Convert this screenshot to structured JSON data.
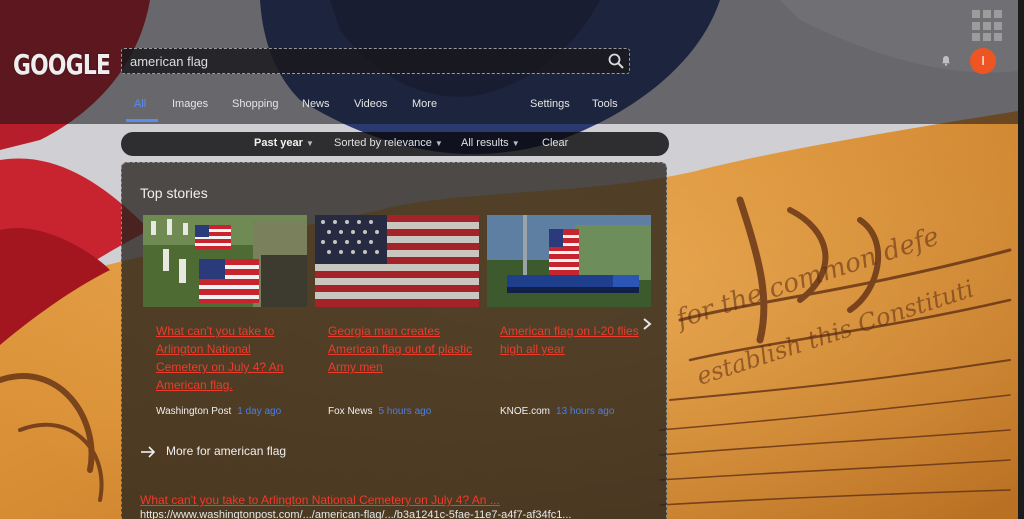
{
  "colors": {
    "accent_blue": "#5b8cf0",
    "link_red": "#ee3b2b",
    "avatar_orange": "#ee5522",
    "time_blue": "#4b7fe0"
  },
  "header": {
    "logo": "GOOGLE",
    "search": {
      "value": "american flag",
      "icon": "search-icon"
    },
    "apps_icon": "apps-grid-icon",
    "bell_icon": "bell-icon",
    "avatar_letter": "I"
  },
  "nav": {
    "tabs": [
      "All",
      "Images",
      "Shopping",
      "News",
      "Videos",
      "More"
    ],
    "active_tab": "All",
    "settings": "Settings",
    "tools": "Tools"
  },
  "filters": {
    "time": "Past year",
    "sort": "Sorted by relevance",
    "results": "All results",
    "clear": "Clear"
  },
  "top_stories": {
    "title": "Top stories",
    "stories": [
      {
        "headline": "What can't you take to Arlington National Cemetery on July 4? An American flag.",
        "source": "Washington Post",
        "time": "1 day ago"
      },
      {
        "headline": "Georgia man creates American flag out of plastic Army men",
        "source": "Fox News",
        "time": "5 hours ago"
      },
      {
        "headline": "American flag on I-20 flies high all year",
        "source": "KNOE.com",
        "time": "13 hours ago"
      }
    ],
    "more_link": "More for american flag"
  },
  "result": {
    "title": "What can't you take to Arlington National Cemetery on July 4? An ...",
    "url": "https://www.washingtonpost.com/.../american-flag/.../b3a1241c-5fae-11e7-a4f7-af34fc1..."
  }
}
